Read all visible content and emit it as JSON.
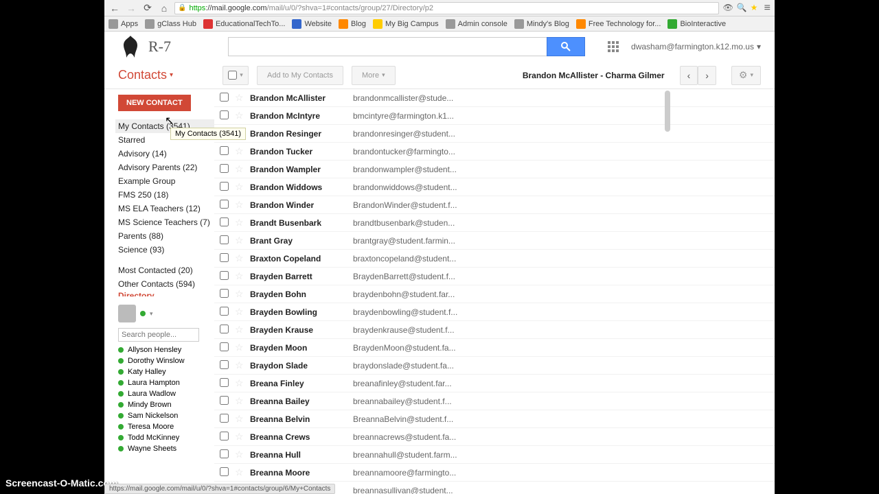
{
  "browser": {
    "url_https": "https",
    "url_host": "://mail.google.com",
    "url_path": "/mail/u/0/?shva=1#contacts/group/27/Directory/p2",
    "bookmarks": [
      {
        "label": "Apps",
        "color": "favicon-gray"
      },
      {
        "label": "gClass Hub",
        "color": "favicon-gray"
      },
      {
        "label": "EducationalTechTo...",
        "color": "favicon-red"
      },
      {
        "label": "Website",
        "color": "favicon-blue"
      },
      {
        "label": "Blog",
        "color": "favicon-orange"
      },
      {
        "label": "My Big Campus",
        "color": "favicon-yellow"
      },
      {
        "label": "Admin console",
        "color": "favicon-gray"
      },
      {
        "label": "Mindy's Blog",
        "color": "favicon-gray"
      },
      {
        "label": "Free Technology for...",
        "color": "favicon-orange"
      },
      {
        "label": "BioInteractive",
        "color": "favicon-green"
      }
    ]
  },
  "header": {
    "logo_text": "R-7",
    "user_email": "dwasham@farmington.k12.mo.us"
  },
  "toolbar": {
    "contacts": "Contacts",
    "add_btn": "Add to My Contacts",
    "more_btn": "More",
    "range": "Brandon McAllister - Charma Gilmer"
  },
  "sidebar": {
    "new_contact": "NEW CONTACT",
    "groups": [
      "My Contacts (3541)",
      "Starred",
      "Advisory (14)",
      "Advisory Parents (22)",
      "Example Group",
      "FMS 250 (18)",
      "MS ELA Teachers (12)",
      "MS Science Teachers (7)",
      "Parents (88)",
      "Science (93)"
    ],
    "secondary": [
      "Most Contacted (20)",
      "Other Contacts (594)"
    ],
    "tooltip": "My Contacts (3541)",
    "chat_search_placeholder": "Search people...",
    "chat_people": [
      "Allyson Hensley",
      "Dorothy Winslow",
      "Katy Halley",
      "Laura Hampton",
      "Laura Wadlow",
      "Mindy Brown",
      "Sam Nickelson",
      "Teresa Moore",
      "Todd McKinney",
      "Wayne Sheets"
    ]
  },
  "contacts": [
    {
      "name": "Brandon McAllister",
      "email": "brandonmcallister@stude..."
    },
    {
      "name": "Brandon McIntyre",
      "email": "bmcintyre@farmington.k1..."
    },
    {
      "name": "Brandon Resinger",
      "email": "brandonresinger@student..."
    },
    {
      "name": "Brandon Tucker",
      "email": "brandontucker@farmingto..."
    },
    {
      "name": "Brandon Wampler",
      "email": "brandonwampler@student..."
    },
    {
      "name": "Brandon Widdows",
      "email": "brandonwiddows@student..."
    },
    {
      "name": "Brandon Winder",
      "email": "BrandonWinder@student.f..."
    },
    {
      "name": "Brandt Busenbark",
      "email": "brandtbusenbark@studen..."
    },
    {
      "name": "Brant Gray",
      "email": "brantgray@student.farmin..."
    },
    {
      "name": "Braxton Copeland",
      "email": "braxtoncopeland@student..."
    },
    {
      "name": "Brayden Barrett",
      "email": "BraydenBarrett@student.f..."
    },
    {
      "name": "Brayden Bohn",
      "email": "braydenbohn@student.far..."
    },
    {
      "name": "Brayden Bowling",
      "email": "braydenbowling@student.f..."
    },
    {
      "name": "Brayden Krause",
      "email": "braydenkrause@student.f..."
    },
    {
      "name": "Brayden Moon",
      "email": "BraydenMoon@student.fa..."
    },
    {
      "name": "Braydon Slade",
      "email": "braydonslade@student.fa..."
    },
    {
      "name": "Breana Finley",
      "email": "breanafinley@student.far..."
    },
    {
      "name": "Breanna Bailey",
      "email": "breannabailey@student.f..."
    },
    {
      "name": "Breanna Belvin",
      "email": "BreannaBelvin@student.f..."
    },
    {
      "name": "Breanna Crews",
      "email": "breannacrews@student.fa..."
    },
    {
      "name": "Breanna Hull",
      "email": "breannahull@student.farm..."
    },
    {
      "name": "Breanna Moore",
      "email": "breannamoore@farmingto..."
    },
    {
      "name": "",
      "email": "breannasullivan@student..."
    }
  ],
  "footer": {
    "watermark": "Screencast-O-Matic.com",
    "status_url": "https://mail.google.com/mail/u/0/?shva=1#contacts/group/6/My+Contacts"
  }
}
